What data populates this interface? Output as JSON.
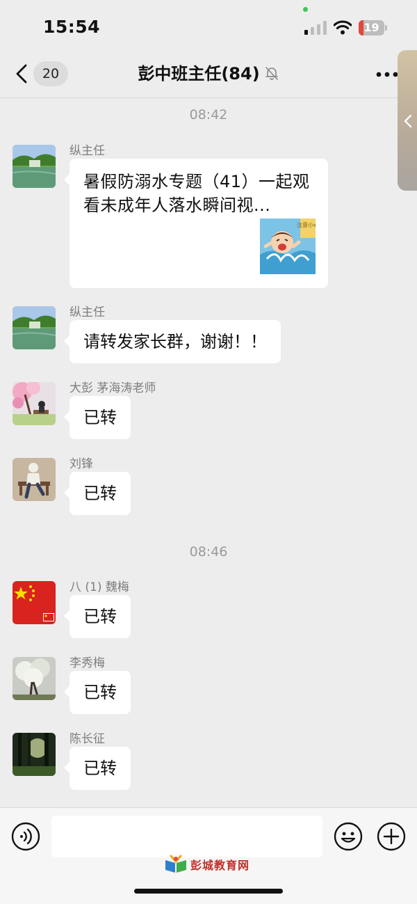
{
  "status_bar": {
    "time": "15:54",
    "battery": "19",
    "battery_level": 0.19
  },
  "header": {
    "unread_count": "20",
    "title": "彭中班主任(84)"
  },
  "timestamps": [
    "08:42",
    "08:46"
  ],
  "messages": [
    {
      "sender": "纵主任",
      "type": "link",
      "text": "暑假防溺水专题（41）一起观看未成年人落水瞬间视...",
      "thumb_caption": "注意小心"
    },
    {
      "sender": "纵主任",
      "type": "text",
      "text": "请转发家长群，谢谢！！"
    },
    {
      "sender": "大彭 茅海涛老师",
      "type": "text",
      "text": "已转"
    },
    {
      "sender": "刘锋",
      "type": "text",
      "text": "已转"
    },
    {
      "sender": "八 (1) 魏梅",
      "type": "text",
      "text": "已转"
    },
    {
      "sender": "李秀梅",
      "type": "text",
      "text": "已转"
    },
    {
      "sender": "陈长征",
      "type": "text",
      "text": "已转"
    }
  ],
  "input": {
    "placeholder": ""
  },
  "watermark": "彭城教育网",
  "colors": {
    "background": "#ededed",
    "bubble": "#ffffff",
    "battery_low": "#e4473e",
    "accent_green": "#3cc75a"
  },
  "icons": [
    "back-chevron-icon",
    "mute-bell-icon",
    "more-icon",
    "voice-icon",
    "emoji-icon",
    "plus-icon"
  ]
}
